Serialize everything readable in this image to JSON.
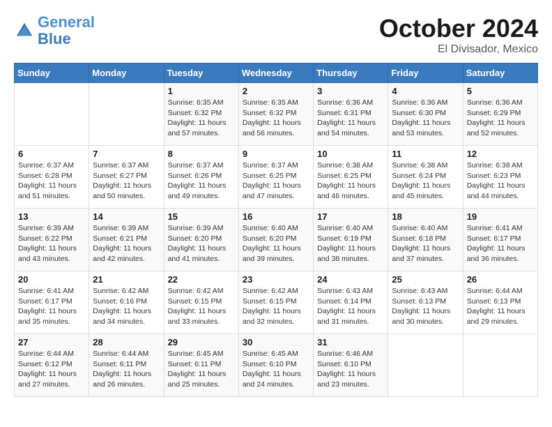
{
  "header": {
    "logo_line1": "General",
    "logo_line2": "Blue",
    "month": "October 2024",
    "location": "El Divisador, Mexico"
  },
  "days_of_week": [
    "Sunday",
    "Monday",
    "Tuesday",
    "Wednesday",
    "Thursday",
    "Friday",
    "Saturday"
  ],
  "weeks": [
    [
      {
        "day": "",
        "info": ""
      },
      {
        "day": "",
        "info": ""
      },
      {
        "day": "1",
        "info": "Sunrise: 6:35 AM\nSunset: 6:32 PM\nDaylight: 11 hours and 57 minutes."
      },
      {
        "day": "2",
        "info": "Sunrise: 6:35 AM\nSunset: 6:32 PM\nDaylight: 11 hours and 56 minutes."
      },
      {
        "day": "3",
        "info": "Sunrise: 6:36 AM\nSunset: 6:31 PM\nDaylight: 11 hours and 54 minutes."
      },
      {
        "day": "4",
        "info": "Sunrise: 6:36 AM\nSunset: 6:30 PM\nDaylight: 11 hours and 53 minutes."
      },
      {
        "day": "5",
        "info": "Sunrise: 6:36 AM\nSunset: 6:29 PM\nDaylight: 11 hours and 52 minutes."
      }
    ],
    [
      {
        "day": "6",
        "info": "Sunrise: 6:37 AM\nSunset: 6:28 PM\nDaylight: 11 hours and 51 minutes."
      },
      {
        "day": "7",
        "info": "Sunrise: 6:37 AM\nSunset: 6:27 PM\nDaylight: 11 hours and 50 minutes."
      },
      {
        "day": "8",
        "info": "Sunrise: 6:37 AM\nSunset: 6:26 PM\nDaylight: 11 hours and 49 minutes."
      },
      {
        "day": "9",
        "info": "Sunrise: 6:37 AM\nSunset: 6:25 PM\nDaylight: 11 hours and 47 minutes."
      },
      {
        "day": "10",
        "info": "Sunrise: 6:38 AM\nSunset: 6:25 PM\nDaylight: 11 hours and 46 minutes."
      },
      {
        "day": "11",
        "info": "Sunrise: 6:38 AM\nSunset: 6:24 PM\nDaylight: 11 hours and 45 minutes."
      },
      {
        "day": "12",
        "info": "Sunrise: 6:38 AM\nSunset: 6:23 PM\nDaylight: 11 hours and 44 minutes."
      }
    ],
    [
      {
        "day": "13",
        "info": "Sunrise: 6:39 AM\nSunset: 6:22 PM\nDaylight: 11 hours and 43 minutes."
      },
      {
        "day": "14",
        "info": "Sunrise: 6:39 AM\nSunset: 6:21 PM\nDaylight: 11 hours and 42 minutes."
      },
      {
        "day": "15",
        "info": "Sunrise: 6:39 AM\nSunset: 6:20 PM\nDaylight: 11 hours and 41 minutes."
      },
      {
        "day": "16",
        "info": "Sunrise: 6:40 AM\nSunset: 6:20 PM\nDaylight: 11 hours and 39 minutes."
      },
      {
        "day": "17",
        "info": "Sunrise: 6:40 AM\nSunset: 6:19 PM\nDaylight: 11 hours and 38 minutes."
      },
      {
        "day": "18",
        "info": "Sunrise: 6:40 AM\nSunset: 6:18 PM\nDaylight: 11 hours and 37 minutes."
      },
      {
        "day": "19",
        "info": "Sunrise: 6:41 AM\nSunset: 6:17 PM\nDaylight: 11 hours and 36 minutes."
      }
    ],
    [
      {
        "day": "20",
        "info": "Sunrise: 6:41 AM\nSunset: 6:17 PM\nDaylight: 11 hours and 35 minutes."
      },
      {
        "day": "21",
        "info": "Sunrise: 6:42 AM\nSunset: 6:16 PM\nDaylight: 11 hours and 34 minutes."
      },
      {
        "day": "22",
        "info": "Sunrise: 6:42 AM\nSunset: 6:15 PM\nDaylight: 11 hours and 33 minutes."
      },
      {
        "day": "23",
        "info": "Sunrise: 6:42 AM\nSunset: 6:15 PM\nDaylight: 11 hours and 32 minutes."
      },
      {
        "day": "24",
        "info": "Sunrise: 6:43 AM\nSunset: 6:14 PM\nDaylight: 11 hours and 31 minutes."
      },
      {
        "day": "25",
        "info": "Sunrise: 6:43 AM\nSunset: 6:13 PM\nDaylight: 11 hours and 30 minutes."
      },
      {
        "day": "26",
        "info": "Sunrise: 6:44 AM\nSunset: 6:13 PM\nDaylight: 11 hours and 29 minutes."
      }
    ],
    [
      {
        "day": "27",
        "info": "Sunrise: 6:44 AM\nSunset: 6:12 PM\nDaylight: 11 hours and 27 minutes."
      },
      {
        "day": "28",
        "info": "Sunrise: 6:44 AM\nSunset: 6:11 PM\nDaylight: 11 hours and 26 minutes."
      },
      {
        "day": "29",
        "info": "Sunrise: 6:45 AM\nSunset: 6:11 PM\nDaylight: 11 hours and 25 minutes."
      },
      {
        "day": "30",
        "info": "Sunrise: 6:45 AM\nSunset: 6:10 PM\nDaylight: 11 hours and 24 minutes."
      },
      {
        "day": "31",
        "info": "Sunrise: 6:46 AM\nSunset: 6:10 PM\nDaylight: 11 hours and 23 minutes."
      },
      {
        "day": "",
        "info": ""
      },
      {
        "day": "",
        "info": ""
      }
    ]
  ]
}
